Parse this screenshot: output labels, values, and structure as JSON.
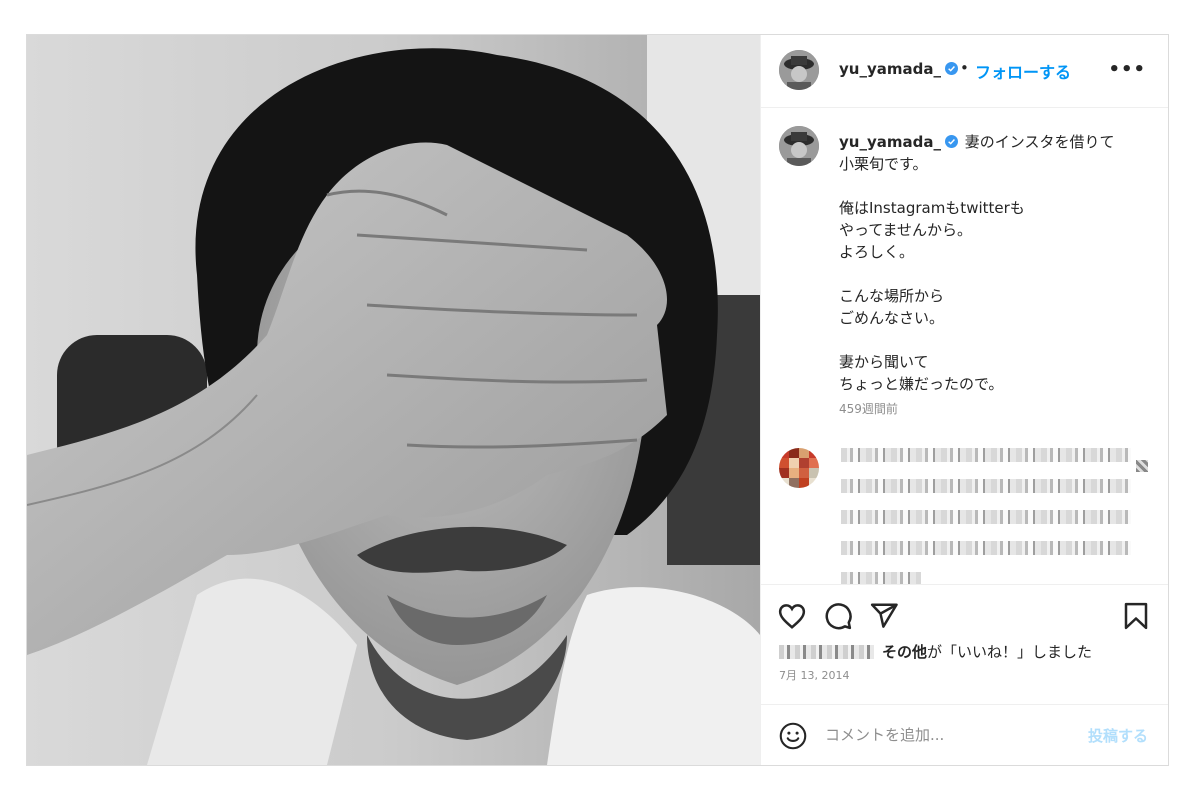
{
  "header": {
    "username": "yu_yamada_",
    "separator": "•",
    "follow_label": "フォローする",
    "more_label": "•••"
  },
  "caption": {
    "username": "yu_yamada_",
    "text": "妻のインスタを借りて\n小栗旬です。\n\n俺はInstagramもtwitterも\nやってませんから。\nよろしく。\n\nこんな場所から\nごめんなさい。\n\n妻から聞いて\nちょっと嫌だったので。",
    "age": "459週間前"
  },
  "likes": {
    "others": "その他",
    "suffix": "が「いいね！」しました"
  },
  "date": "7月 13, 2014",
  "comment_box": {
    "placeholder": "コメントを追加...",
    "post_label": "投稿する"
  },
  "icons": {
    "verified": "verified-badge-icon",
    "like": "heart-icon",
    "comment": "comment-bubble-icon",
    "share": "paper-plane-icon",
    "save": "bookmark-icon",
    "emoji": "smiley-icon",
    "more": "ellipsis-icon"
  },
  "colors": {
    "accent": "#0095f6",
    "verified": "#3897f0",
    "post_disabled": "#b2dffc",
    "muted": "#8e8e8e",
    "text": "#262626",
    "border": "#dbdbdb"
  }
}
